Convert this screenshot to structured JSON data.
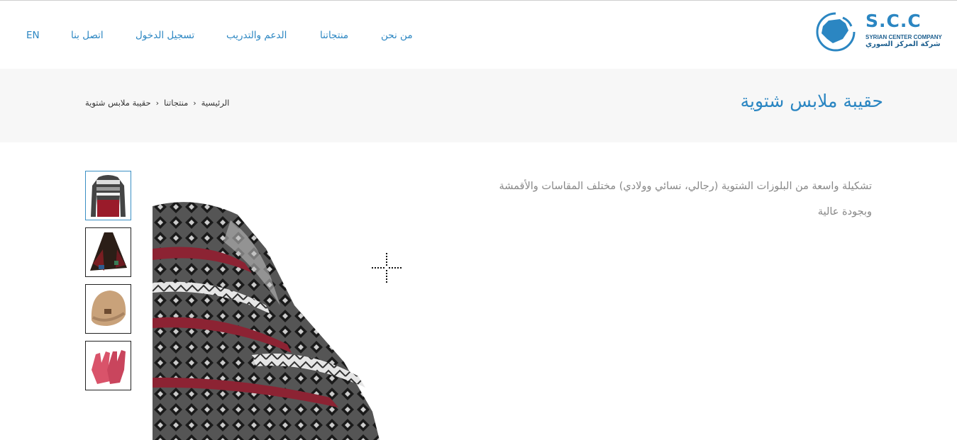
{
  "header": {
    "logo": {
      "abbr": "S.C.C",
      "name_en": "SYRIAN CENTER COMPANY",
      "name_ar": "شركة المركز السوري"
    },
    "nav": [
      {
        "label": "من نحن"
      },
      {
        "label": "منتجاتنا"
      },
      {
        "label": "الدعم والتدريب"
      },
      {
        "label": "تسجيل الدخول"
      },
      {
        "label": "اتصل بنا"
      },
      {
        "label": "EN"
      }
    ]
  },
  "page": {
    "title": "حقيبة ملابس شتوية",
    "breadcrumb": [
      "الرئيسية",
      "منتجاتنا",
      "حقيبة ملابس شتوية"
    ]
  },
  "product": {
    "description": "تشكيلة واسعة من البلوزات الشتوية (رجالي، نسائي وولادي) مختلف المقاسات والأقمشة وبجودة عالية",
    "thumbnails": [
      {
        "icon": "sweater-thumbnail",
        "selected": true
      },
      {
        "icon": "poncho-thumbnail",
        "selected": false
      },
      {
        "icon": "beanie-hat-thumbnail",
        "selected": false
      },
      {
        "icon": "gloves-thumbnail",
        "selected": false
      }
    ]
  },
  "colors": {
    "accent": "#2b86c2",
    "band": "#f7f7f7",
    "text_muted": "#888888"
  }
}
